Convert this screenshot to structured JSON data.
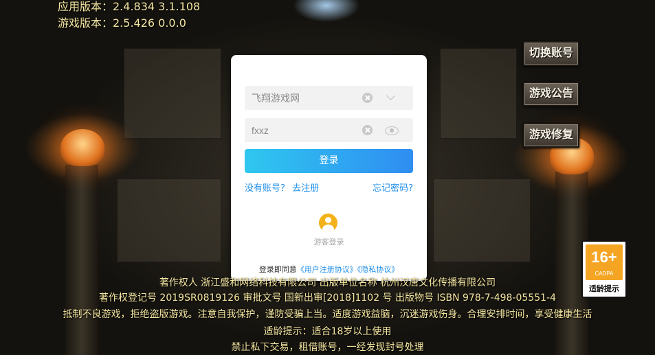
{
  "version": {
    "app": "应用版本：2.4.834  3.1.108",
    "game": "游戏版本：2.5.426  0.0.0"
  },
  "side_buttons": {
    "switch_account": "切换账号",
    "announcement": "游戏公告",
    "repair": "游戏修复"
  },
  "login": {
    "account_value": "飞翔游戏网",
    "password_value": "fxxz",
    "login_label": "登录",
    "no_account": "没有账号？ 去注册",
    "forgot": "忘记密码?",
    "guest_label": "游客登录",
    "agree_prefix": "登录即同意",
    "user_agreement": "《用户注册协议》",
    "privacy": "《隐私协议》"
  },
  "age_rating": {
    "number": "16+",
    "org": "CADPA",
    "tip": "适龄提示"
  },
  "footer": {
    "line1": "著作权人 浙江盛和网络科技有限公司 出版单位名称 杭州汉唐文化传播有限公司",
    "line2": "著作权登记号 2019SR0819126 审批文号 国新出审[2018]1102 号 出版物号 ISBN 978-7-498-05551-4",
    "line3": "抵制不良游戏，拒绝盗版游戏。注意自我保护，谨防受骗上当。适度游戏益脑，沉迷游戏伤身。合理安排时间，享受健康生活",
    "line4": "适龄提示：适合18岁以上使用",
    "line5": "禁止私下交易，租借账号，一经发现封号处理"
  },
  "colors": {
    "accent_gradient_start": "#2fc7ef",
    "accent_gradient_end": "#2f8df2",
    "link": "#1e8ee8",
    "footer_text": "#f4e6a0",
    "age_badge": "#f5a524"
  }
}
